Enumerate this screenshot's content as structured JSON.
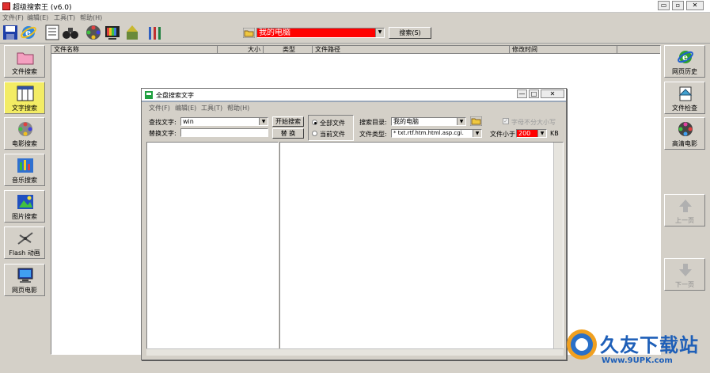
{
  "window": {
    "title": "超级搜索王 (v6.0)",
    "min": "▭",
    "max": "▫",
    "close": "✕"
  },
  "menu": [
    "文件(F)",
    "编辑(E)",
    "工具(T)",
    "帮助(H)"
  ],
  "search_bar": {
    "location": "我的电脑",
    "button": "搜索(S)",
    "dropdown_glyph": "▼"
  },
  "left_nav": [
    {
      "label": "文件搜索",
      "icon": "folder-icon"
    },
    {
      "label": "文字搜索",
      "icon": "text-icon",
      "active": true
    },
    {
      "label": "电影搜索",
      "icon": "film-reel-icon"
    },
    {
      "label": "音乐搜索",
      "icon": "music-icon"
    },
    {
      "label": "图片搜索",
      "icon": "picture-icon"
    },
    {
      "label": "Flash 动画",
      "icon": "flash-icon"
    },
    {
      "label": "网页电影",
      "icon": "monitor-icon"
    }
  ],
  "right_nav": [
    {
      "label": "网页历史",
      "icon": "ie-icon"
    },
    {
      "label": "文件检查",
      "icon": "file-check-icon"
    },
    {
      "label": "高清电影",
      "icon": "hd-movie-icon"
    },
    {
      "label": "上一页",
      "icon": "arrow-up-icon",
      "disabled": true
    },
    {
      "label": "下一页",
      "icon": "arrow-down-icon",
      "disabled": true
    }
  ],
  "results_columns": [
    "文件名称",
    "大小",
    "类型",
    "文件路径",
    "修改时间"
  ],
  "dialog": {
    "title": "全盘搜索文字",
    "menu": [
      "文件(F)",
      "编辑(E)",
      "工具(T)",
      "帮助(H)"
    ],
    "find_label": "查找文字:",
    "find_value": "win",
    "replace_label": "替换文字:",
    "replace_value": "",
    "start_button": "开始搜索",
    "replace_button": "替 换",
    "radio_all": "全部文件",
    "radio_current": "当前文件",
    "dir_label": "搜索目录:",
    "dir_value": "我的电脑",
    "case_label": "字母不分大小写",
    "type_label": "文件类型:",
    "type_value": "* txt.rtf.htm.html.asp.cgi.",
    "size_label": "文件小于",
    "size_value": "200",
    "size_unit": "KB",
    "min": "—",
    "max": "□",
    "close": "✕"
  },
  "watermark": {
    "text": "久友下载站",
    "url": "Www.9UPK.com"
  }
}
